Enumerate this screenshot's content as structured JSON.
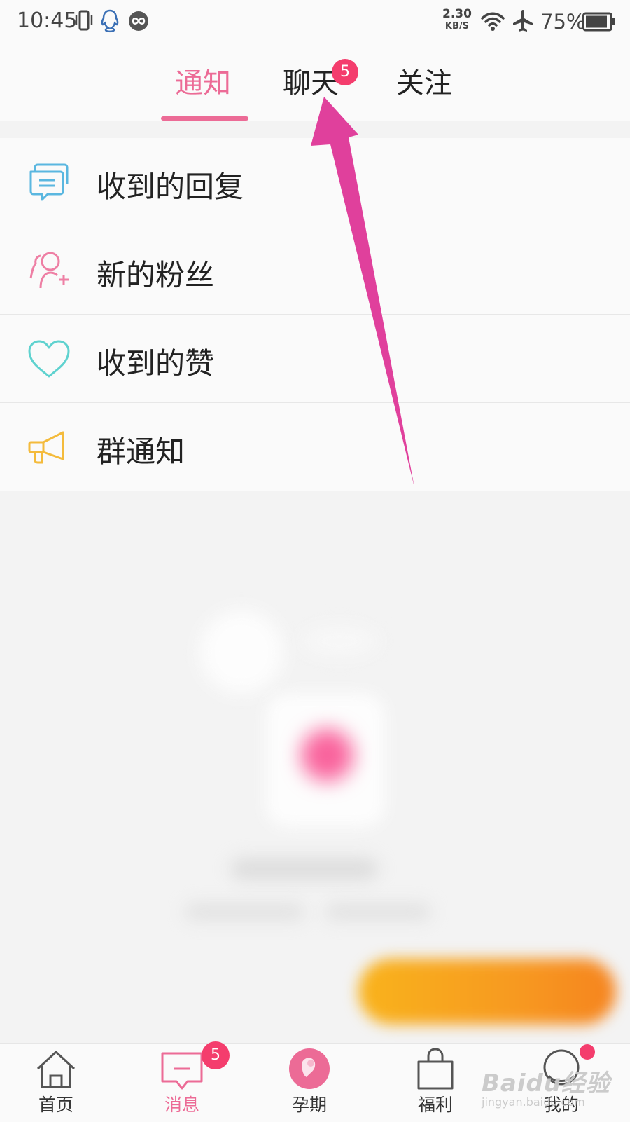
{
  "status_bar": {
    "time": "10:45",
    "net_speed_value": "2.30",
    "net_speed_unit": "KB/S",
    "battery": "75%",
    "icons": [
      "vibrate-icon",
      "qq-icon",
      "loop-icon",
      "wifi-icon",
      "airplane-icon",
      "battery-icon"
    ]
  },
  "tabs": [
    {
      "label": "通知",
      "active": true
    },
    {
      "label": "聊天",
      "active": false,
      "badge": "5"
    },
    {
      "label": "关注",
      "active": false
    }
  ],
  "notices": [
    {
      "label": "收到的回复",
      "icon": "reply-bubble-icon",
      "color": "#5ab7e0"
    },
    {
      "label": "新的粉丝",
      "icon": "add-fan-icon",
      "color": "#ee7fa4"
    },
    {
      "label": "收到的赞",
      "icon": "heart-icon",
      "color": "#5fd2cf"
    },
    {
      "label": "群通知",
      "icon": "megaphone-icon",
      "color": "#f4bb3c"
    }
  ],
  "bottom_nav": [
    {
      "label": "首页",
      "icon": "home-icon"
    },
    {
      "label": "消息",
      "icon": "message-icon",
      "active": true,
      "badge": "5"
    },
    {
      "label": "孕期",
      "icon": "pregnancy-icon"
    },
    {
      "label": "福利",
      "icon": "shopping-bag-icon"
    },
    {
      "label": "我的",
      "icon": "profile-icon",
      "dot": true
    }
  ],
  "watermark": {
    "brand": "Baidu经验",
    "url": "jingyan.baidu.com"
  },
  "colors": {
    "accent": "#ec6b96",
    "badge": "#f43d6d",
    "arrow": "#e0409c",
    "float_button": "#f7a020"
  }
}
